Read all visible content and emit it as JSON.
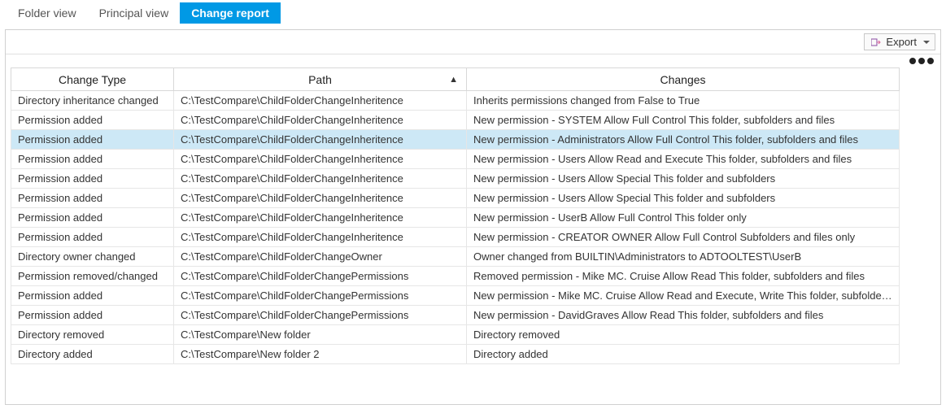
{
  "tabs": [
    {
      "label": "Folder view",
      "active": false
    },
    {
      "label": "Principal view",
      "active": false
    },
    {
      "label": "Change report",
      "active": true
    }
  ],
  "toolbar": {
    "export_label": "Export"
  },
  "grid": {
    "columns": {
      "type": "Change Type",
      "path": "Path",
      "changes": "Changes"
    },
    "sorted_column": "path",
    "rows": [
      {
        "type": "Directory inheritance changed",
        "path": "C:\\TestCompare\\ChildFolderChangeInheritence",
        "changes": "Inherits permissions changed from False to True",
        "selected": false
      },
      {
        "type": "Permission added",
        "path": "C:\\TestCompare\\ChildFolderChangeInheritence",
        "changes": "New permission - SYSTEM Allow Full Control This folder, subfolders and files",
        "selected": false
      },
      {
        "type": "Permission added",
        "path": "C:\\TestCompare\\ChildFolderChangeInheritence",
        "changes": "New permission - Administrators Allow Full Control This folder, subfolders and files",
        "selected": true
      },
      {
        "type": "Permission added",
        "path": "C:\\TestCompare\\ChildFolderChangeInheritence",
        "changes": "New permission - Users Allow Read and Execute This folder, subfolders and files",
        "selected": false
      },
      {
        "type": "Permission added",
        "path": "C:\\TestCompare\\ChildFolderChangeInheritence",
        "changes": "New permission - Users Allow Special This folder and subfolders",
        "selected": false
      },
      {
        "type": "Permission added",
        "path": "C:\\TestCompare\\ChildFolderChangeInheritence",
        "changes": "New permission - Users Allow Special This folder and subfolders",
        "selected": false
      },
      {
        "type": "Permission added",
        "path": "C:\\TestCompare\\ChildFolderChangeInheritence",
        "changes": "New permission - UserB Allow Full Control This folder only",
        "selected": false
      },
      {
        "type": "Permission added",
        "path": "C:\\TestCompare\\ChildFolderChangeInheritence",
        "changes": "New permission - CREATOR OWNER Allow Full Control Subfolders and files only",
        "selected": false
      },
      {
        "type": "Directory owner changed",
        "path": "C:\\TestCompare\\ChildFolderChangeOwner",
        "changes": "Owner changed from BUILTIN\\Administrators to ADTOOLTEST\\UserB",
        "selected": false
      },
      {
        "type": "Permission removed/changed",
        "path": "C:\\TestCompare\\ChildFolderChangePermissions",
        "changes": "Removed permission - Mike MC. Cruise Allow Read This folder, subfolders and files",
        "selected": false
      },
      {
        "type": "Permission added",
        "path": "C:\\TestCompare\\ChildFolderChangePermissions",
        "changes": "New permission - Mike MC. Cruise Allow Read and Execute, Write This folder, subfolders and files",
        "selected": false
      },
      {
        "type": "Permission added",
        "path": "C:\\TestCompare\\ChildFolderChangePermissions",
        "changes": "New permission - DavidGraves Allow Read This folder, subfolders and files",
        "selected": false
      },
      {
        "type": "Directory removed",
        "path": "C:\\TestCompare\\New folder",
        "changes": "Directory removed",
        "selected": false
      },
      {
        "type": "Directory added",
        "path": "C:\\TestCompare\\New folder 2",
        "changes": "Directory added",
        "selected": false
      }
    ]
  }
}
